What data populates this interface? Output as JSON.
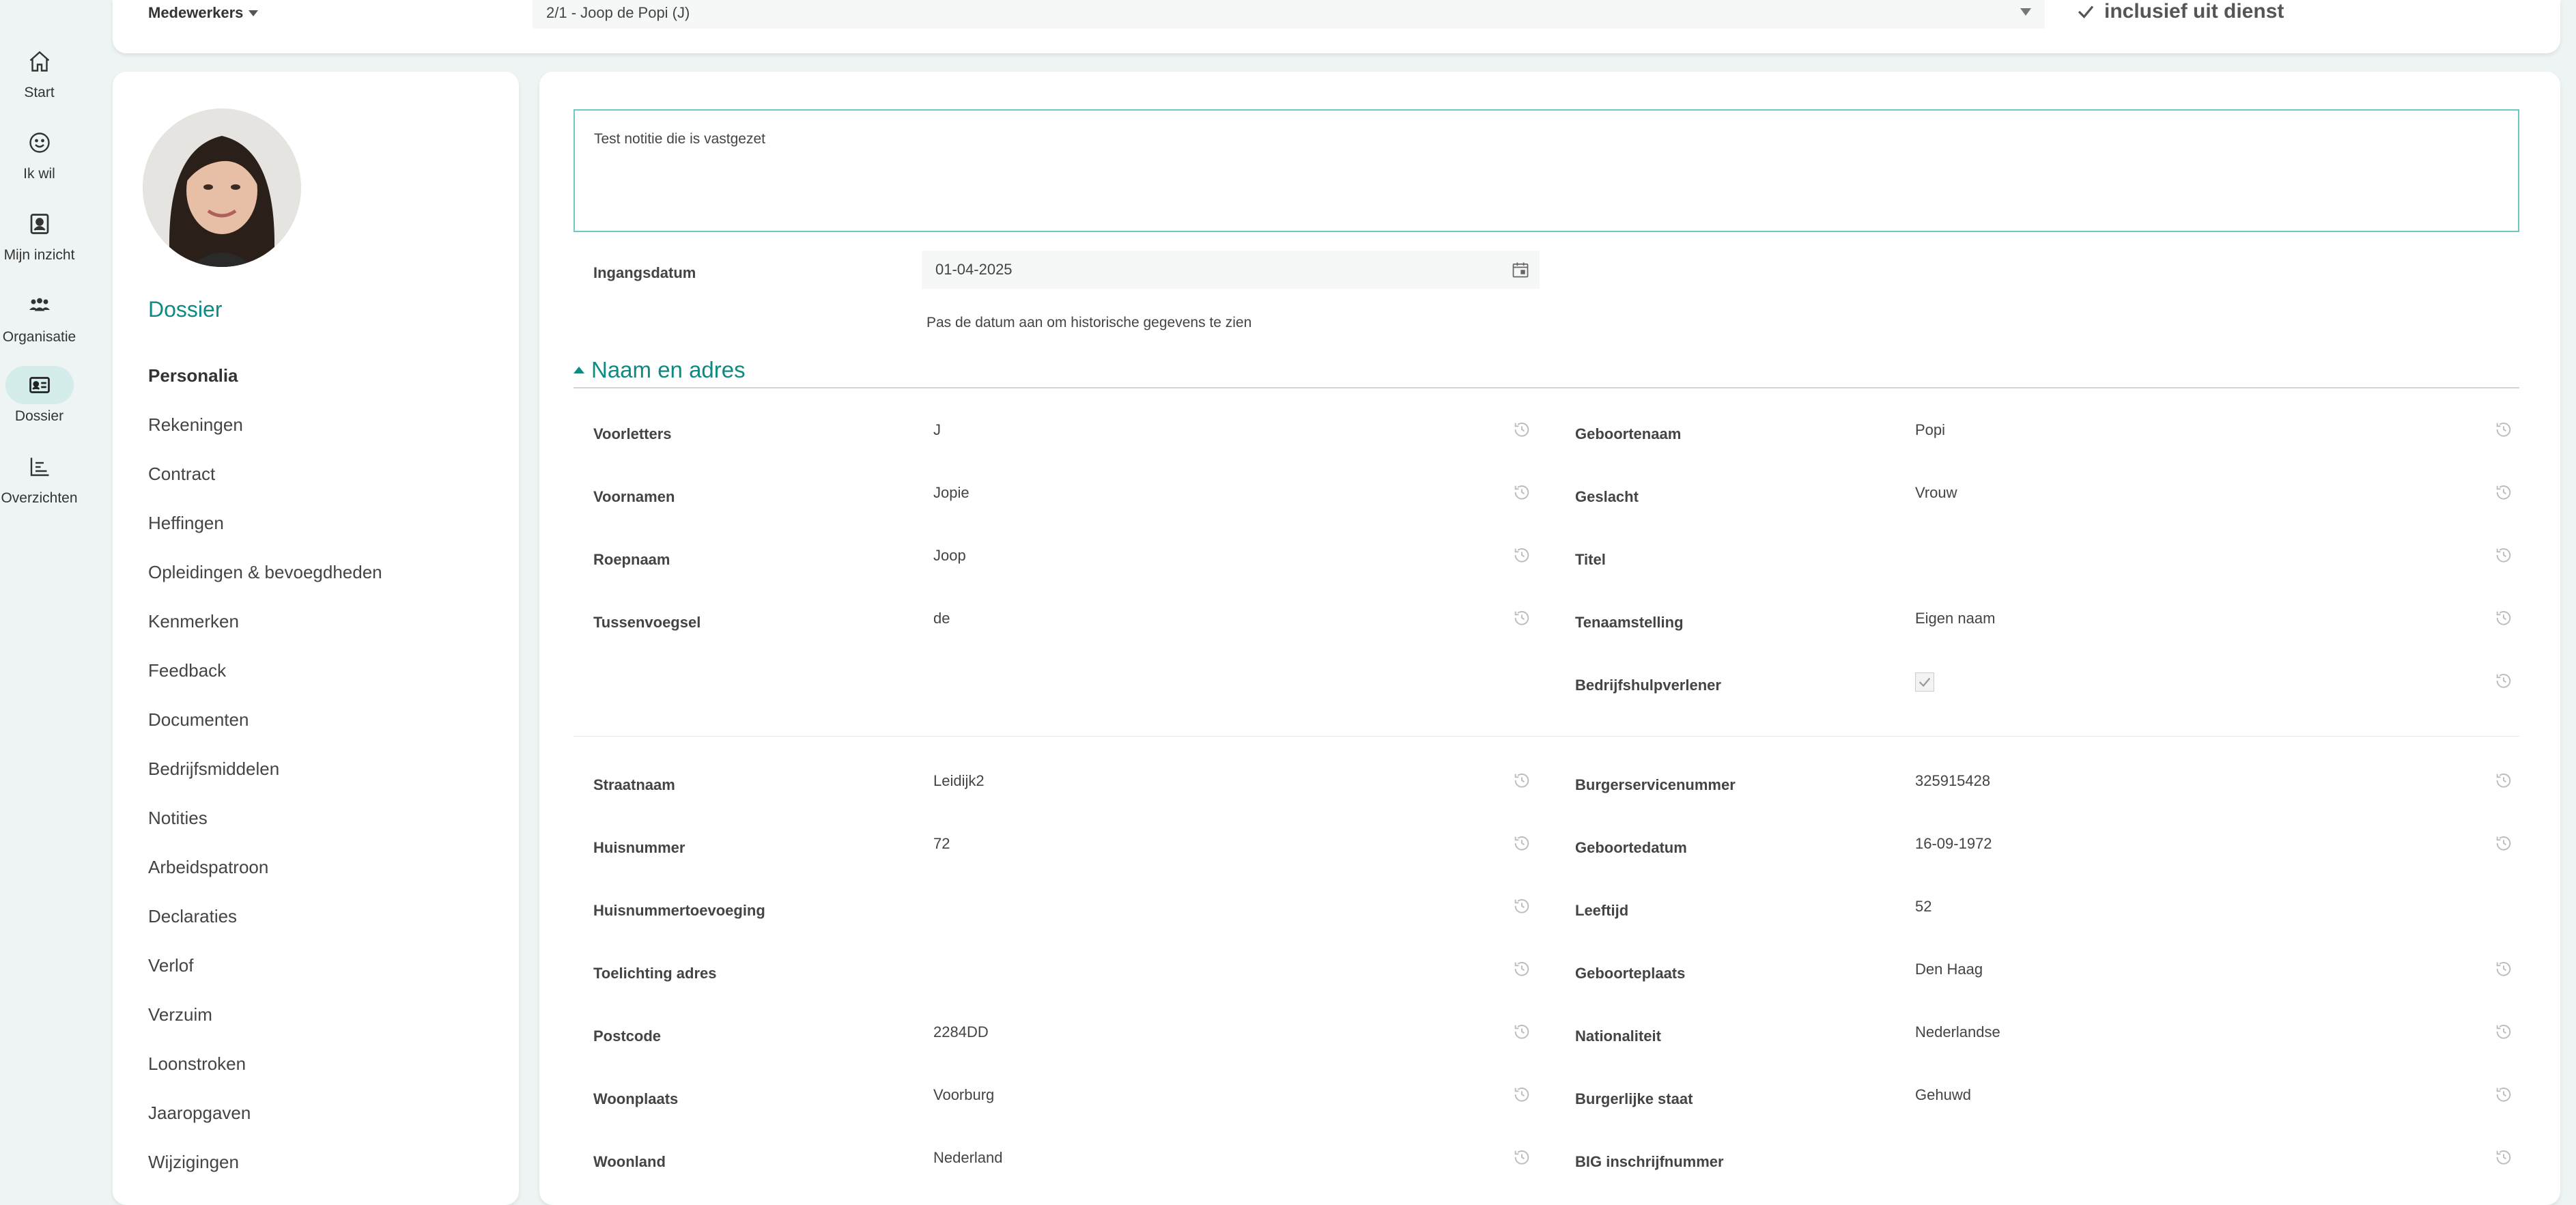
{
  "rail": [
    {
      "label": "Start",
      "icon": "home-icon"
    },
    {
      "label": "Ik wil",
      "icon": "smiley-icon"
    },
    {
      "label": "Mijn inzicht",
      "icon": "person-card-icon"
    },
    {
      "label": "Organisatie",
      "icon": "people-group-icon"
    },
    {
      "label": "Dossier",
      "icon": "id-card-icon"
    },
    {
      "label": "Overzichten",
      "icon": "bar-chart-icon"
    }
  ],
  "topbar": {
    "employees_label": "Medewerkers",
    "employee_selected": "2/1 - Joop de Popi (J)",
    "include_label": "inclusief uit dienst"
  },
  "left": {
    "title": "Dossier",
    "nav": [
      "Personalia",
      "Rekeningen",
      "Contract",
      "Heffingen",
      "Opleidingen & bevoegdheden",
      "Kenmerken",
      "Feedback",
      "Documenten",
      "Bedrijfsmiddelen",
      "Notities",
      "Arbeidspatroon",
      "Declaraties",
      "Verlof",
      "Verzuim",
      "Loonstroken",
      "Jaaropgaven",
      "Wijzigingen"
    ]
  },
  "main": {
    "note": "Test notitie die is vastgezet",
    "ingangsdatum_label": "Ingangsdatum",
    "ingangsdatum_value": "01-04-2025",
    "hint": "Pas de datum aan om historische gegevens te zien",
    "section_title": "Naam en adres",
    "left_fields": [
      {
        "label": "Voorletters",
        "value": "J"
      },
      {
        "label": "Voornamen",
        "value": "Jopie"
      },
      {
        "label": "Roepnaam",
        "value": "Joop"
      },
      {
        "label": "Tussenvoegsel",
        "value": "de"
      },
      {
        "label": "Straatnaam",
        "value": "Leidijk2"
      },
      {
        "label": "Huisnummer",
        "value": "72"
      },
      {
        "label": "Huisnummertoevoeging",
        "value": ""
      },
      {
        "label": "Toelichting adres",
        "value": ""
      },
      {
        "label": "Postcode",
        "value": "2284DD"
      },
      {
        "label": "Woonplaats",
        "value": "Voorburg"
      },
      {
        "label": "Woonland",
        "value": "Nederland"
      }
    ],
    "right_fields": [
      {
        "label": "Geboortenaam",
        "value": "Popi"
      },
      {
        "label": "Geslacht",
        "value": "Vrouw"
      },
      {
        "label": "Titel",
        "value": ""
      },
      {
        "label": "Tenaamstelling",
        "value": "Eigen naam"
      },
      {
        "label": "Bedrijfshulpverlener",
        "value": ""
      },
      {
        "label": "Burgerservicenummer",
        "value": "325915428"
      },
      {
        "label": "Geboortedatum",
        "value": "16-09-1972"
      },
      {
        "label": "Leeftijd",
        "value": "52"
      },
      {
        "label": "Geboorteplaats",
        "value": "Den Haag"
      },
      {
        "label": "Nationaliteit",
        "value": "Nederlandse"
      },
      {
        "label": "Burgerlijke staat",
        "value": "Gehuwd"
      },
      {
        "label": "BIG inschrijfnummer",
        "value": ""
      }
    ]
  }
}
